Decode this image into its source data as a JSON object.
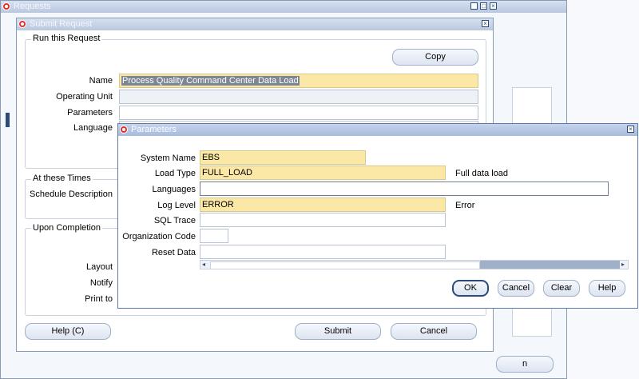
{
  "requests_window": {
    "title": "Requests",
    "right_button": "n"
  },
  "submit_request": {
    "title": "Submit Request",
    "run_group": "Run this Request",
    "copy_label": "Copy",
    "name_label": "Name",
    "name_value": "Process Quality Command Center Data Load",
    "operating_unit_label": "Operating Unit",
    "parameters_label": "Parameters",
    "language_label": "Language",
    "times_group": "At these Times",
    "schedule_label": "Schedule Description",
    "completion_group": "Upon Completion",
    "layout_label": "Layout",
    "notify_label": "Notify",
    "print_label": "Print to",
    "help_label": "Help (C)",
    "submit_label": "Submit",
    "cancel_label": "Cancel"
  },
  "parameters": {
    "title": "Parameters",
    "system_name_label": "System Name",
    "system_name_value": "EBS",
    "load_type_label": "Load Type",
    "load_type_value": "FULL_LOAD",
    "load_type_desc": "Full data load",
    "languages_label": "Languages",
    "languages_value": "",
    "log_level_label": "Log Level",
    "log_level_value": "ERROR",
    "log_level_desc": "Error",
    "sql_trace_label": "SQL Trace",
    "org_code_label": "Organization Code",
    "reset_data_label": "Reset Data",
    "ok_label": "OK",
    "cancel_label": "Cancel",
    "clear_label": "Clear",
    "help_label": "Help"
  }
}
